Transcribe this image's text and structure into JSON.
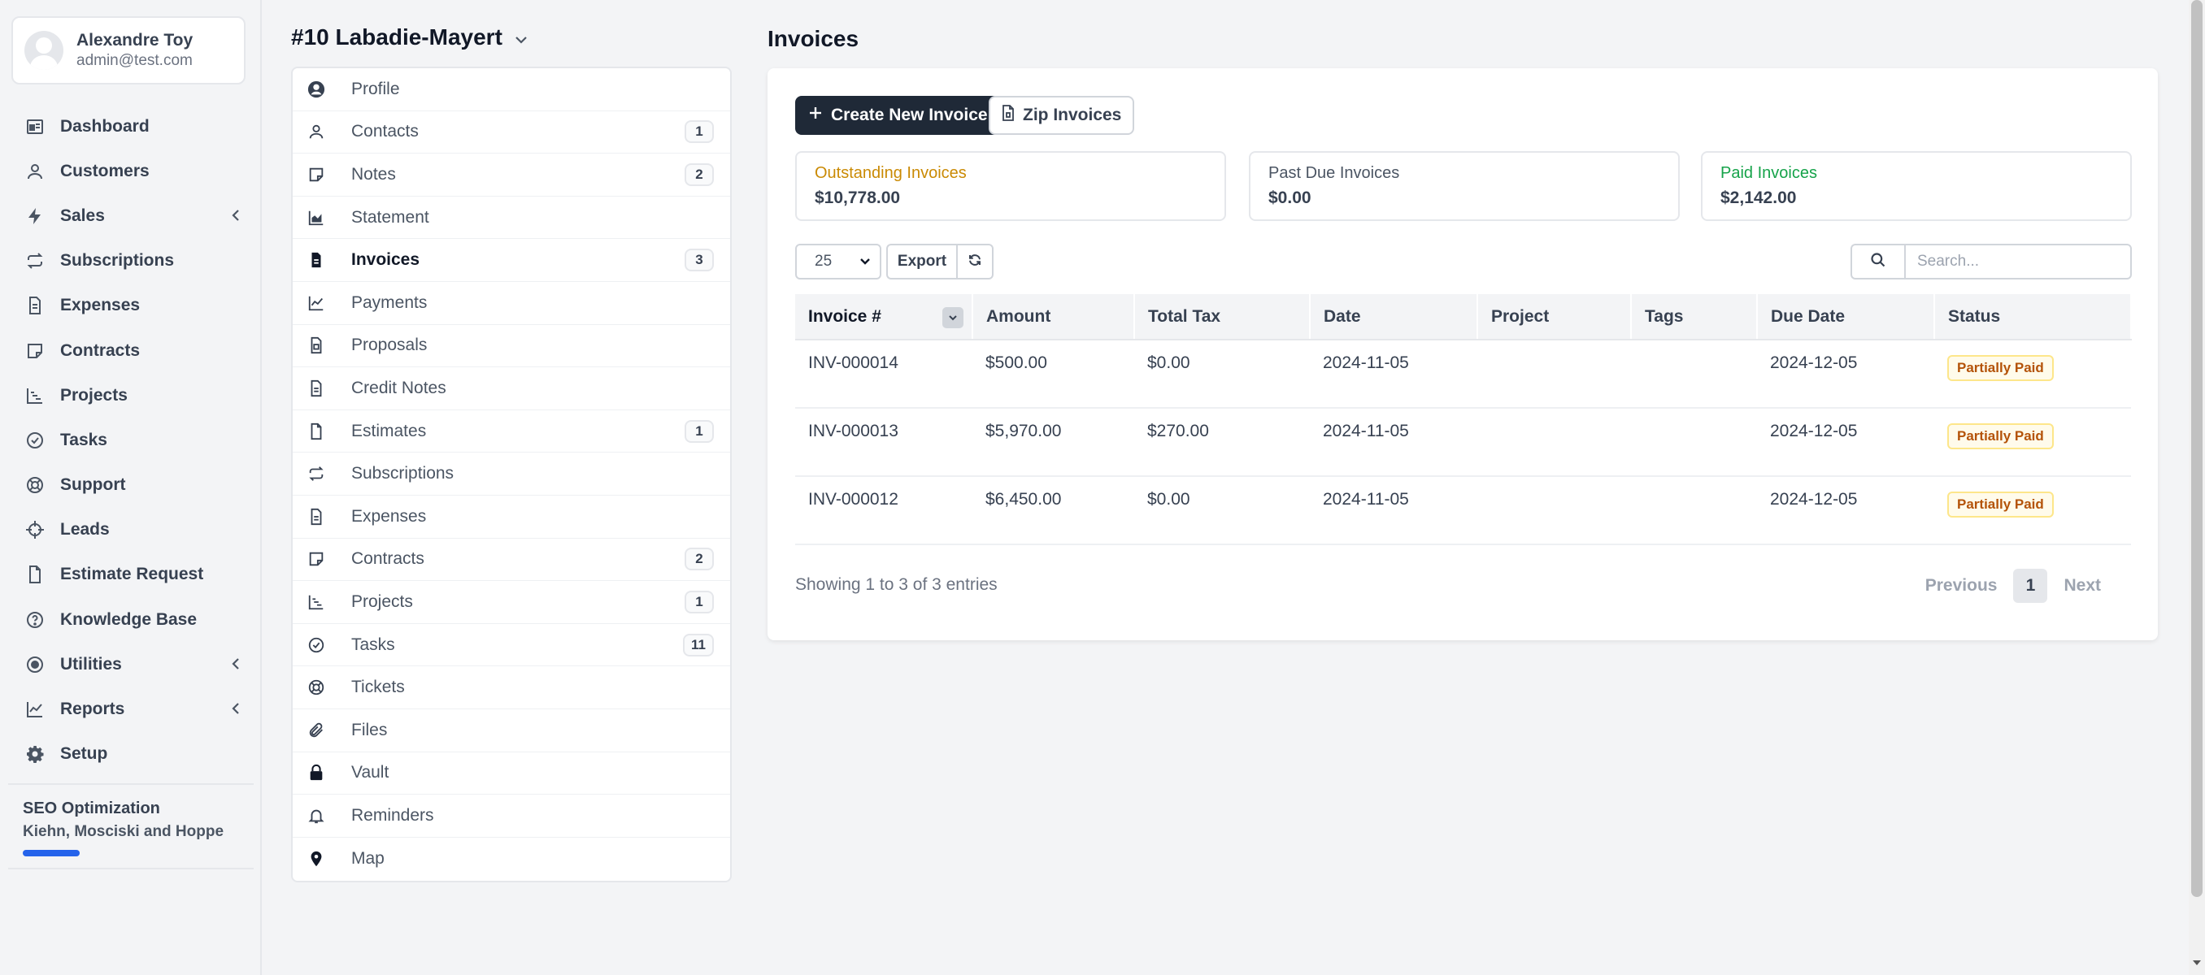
{
  "user": {
    "name": "Alexandre Toy",
    "email": "admin@test.com"
  },
  "sidebar": {
    "items": [
      {
        "label": "Dashboard",
        "icon": "dashboard-icon"
      },
      {
        "label": "Customers",
        "icon": "user-icon"
      },
      {
        "label": "Sales",
        "icon": "bolt-icon",
        "has_submenu": true
      },
      {
        "label": "Subscriptions",
        "icon": "repeat-icon"
      },
      {
        "label": "Expenses",
        "icon": "document-icon"
      },
      {
        "label": "Contracts",
        "icon": "contract-icon"
      },
      {
        "label": "Projects",
        "icon": "projects-chart-icon"
      },
      {
        "label": "Tasks",
        "icon": "check-circle-icon"
      },
      {
        "label": "Support",
        "icon": "lifebuoy-icon"
      },
      {
        "label": "Leads",
        "icon": "crosshair-icon"
      },
      {
        "label": "Estimate Request",
        "icon": "file-icon"
      },
      {
        "label": "Knowledge Base",
        "icon": "question-circle-icon"
      },
      {
        "label": "Utilities",
        "icon": "target-icon",
        "has_submenu": true
      },
      {
        "label": "Reports",
        "icon": "line-chart-icon",
        "has_submenu": true
      },
      {
        "label": "Setup",
        "icon": "gear-icon"
      }
    ],
    "project": {
      "title": "SEO Optimization",
      "client": "Kiehn, Mosciski and Hoppe",
      "progress": 0.27
    }
  },
  "client": {
    "title": "#10 Labadie-Mayert",
    "menu": [
      {
        "label": "Profile",
        "icon": "user-circle-icon",
        "badge": ""
      },
      {
        "label": "Contacts",
        "icon": "user-icon",
        "badge": "1"
      },
      {
        "label": "Notes",
        "icon": "note-icon",
        "badge": "2"
      },
      {
        "label": "Statement",
        "icon": "area-chart-icon",
        "badge": ""
      },
      {
        "label": "Invoices",
        "icon": "invoice-icon",
        "badge": "3",
        "active": true
      },
      {
        "label": "Payments",
        "icon": "line-chart-icon",
        "badge": ""
      },
      {
        "label": "Proposals",
        "icon": "proposal-icon",
        "badge": ""
      },
      {
        "label": "Credit Notes",
        "icon": "document-icon",
        "badge": ""
      },
      {
        "label": "Estimates",
        "icon": "file-icon",
        "badge": "1"
      },
      {
        "label": "Subscriptions",
        "icon": "repeat-icon",
        "badge": ""
      },
      {
        "label": "Expenses",
        "icon": "document-icon",
        "badge": ""
      },
      {
        "label": "Contracts",
        "icon": "contract-icon",
        "badge": "2"
      },
      {
        "label": "Projects",
        "icon": "projects-chart-icon",
        "badge": "1"
      },
      {
        "label": "Tasks",
        "icon": "check-circle-icon",
        "badge": "11"
      },
      {
        "label": "Tickets",
        "icon": "lifebuoy-icon",
        "badge": ""
      },
      {
        "label": "Files",
        "icon": "paperclip-icon",
        "badge": ""
      },
      {
        "label": "Vault",
        "icon": "lock-icon",
        "badge": ""
      },
      {
        "label": "Reminders",
        "icon": "bell-icon",
        "badge": ""
      },
      {
        "label": "Map",
        "icon": "map-pin-icon",
        "badge": ""
      }
    ]
  },
  "invoices": {
    "page_title": "Invoices",
    "create_label": "Create New Invoice",
    "zip_label": "Zip Invoices",
    "stats": {
      "outstanding": {
        "label": "Outstanding Invoices",
        "value": "$10,778.00",
        "color": "#ca8a04"
      },
      "past_due": {
        "label": "Past Due Invoices",
        "value": "$0.00",
        "color": "#4b5563"
      },
      "paid": {
        "label": "Paid Invoices",
        "value": "$2,142.00",
        "color": "#16a34a"
      }
    },
    "page_size": "25",
    "export_label": "Export",
    "search_placeholder": "Search...",
    "columns": [
      "Invoice #",
      "Amount",
      "Total Tax",
      "Date",
      "Project",
      "Tags",
      "Due Date",
      "Status"
    ],
    "rows": [
      {
        "number": "INV-000014",
        "amount": "$500.00",
        "tax": "$0.00",
        "date": "2024-11-05",
        "project": "",
        "tags": "",
        "due": "2024-12-05",
        "status": "Partially Paid"
      },
      {
        "number": "INV-000013",
        "amount": "$5,970.00",
        "tax": "$270.00",
        "date": "2024-11-05",
        "project": "",
        "tags": "",
        "due": "2024-12-05",
        "status": "Partially Paid"
      },
      {
        "number": "INV-000012",
        "amount": "$6,450.00",
        "tax": "$0.00",
        "date": "2024-11-05",
        "project": "",
        "tags": "",
        "due": "2024-12-05",
        "status": "Partially Paid"
      }
    ],
    "footer": {
      "showing": "Showing 1 to 3 of 3 entries",
      "previous": "Previous",
      "page": "1",
      "next": "Next"
    }
  }
}
